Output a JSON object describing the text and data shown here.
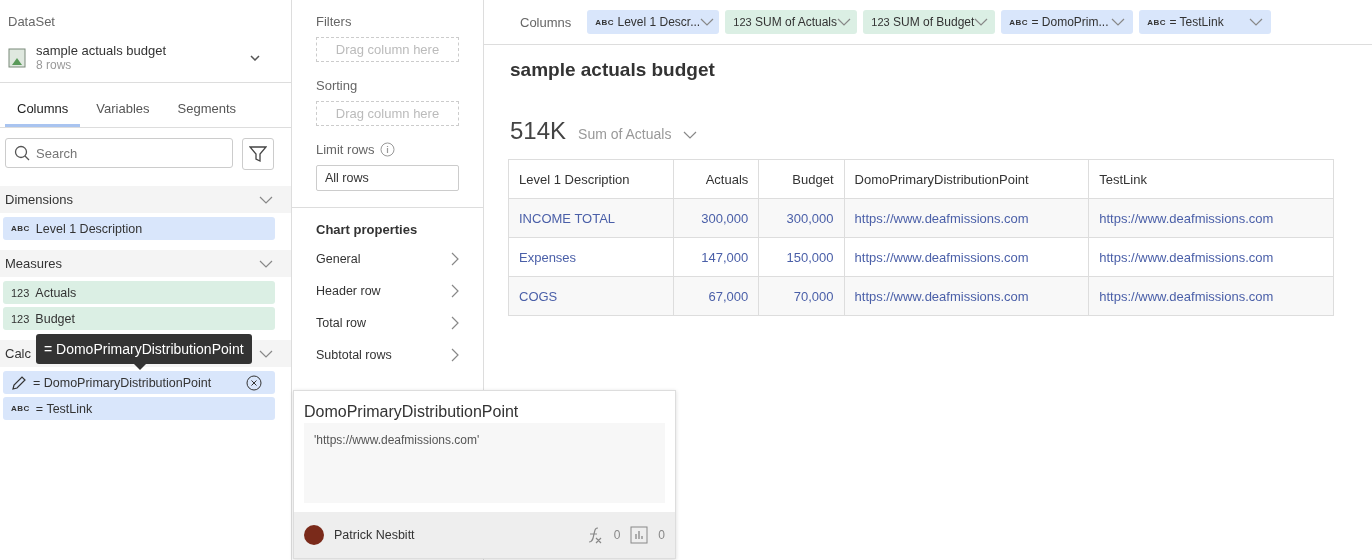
{
  "dataset": {
    "label": "DataSet",
    "name": "sample actuals budget",
    "rows": "8 rows"
  },
  "tabs": [
    {
      "label": "Columns",
      "selected": true
    },
    {
      "label": "Variables",
      "selected": false
    },
    {
      "label": "Segments",
      "selected": false
    }
  ],
  "search": {
    "placeholder": "Search"
  },
  "sections": [
    {
      "title": "Dimensions",
      "expanded": true,
      "items": [
        {
          "kind": "dimension",
          "type": "ABC",
          "label": "Level 1 Description",
          "hovered": false
        }
      ]
    },
    {
      "title": "Measures",
      "expanded": true,
      "items": [
        {
          "kind": "measure",
          "type": "123",
          "label": "Actuals",
          "hovered": false
        },
        {
          "kind": "measure",
          "type": "123",
          "label": "Budget",
          "hovered": false
        }
      ]
    },
    {
      "title": "Calc",
      "expanded": true,
      "items": [
        {
          "kind": "dimension",
          "label": "= DomoPrimaryDistributionPoint",
          "hovered": true
        },
        {
          "kind": "dimension",
          "type": "ABC",
          "label": "= TestLink",
          "hovered": false
        }
      ]
    }
  ],
  "tooltip": "= DomoPrimaryDistributionPoint",
  "filters": {
    "label": "Filters",
    "placeholder": "Drag column here"
  },
  "sorting": {
    "label": "Sorting",
    "placeholder": "Drag column here"
  },
  "limit_rows": {
    "label": "Limit rows",
    "value": "All rows"
  },
  "chart_properties": {
    "title": "Chart properties",
    "items": [
      "General",
      "Header row",
      "Total row",
      "Subtotal rows"
    ]
  },
  "columns_bar": {
    "label": "Columns",
    "chips": [
      {
        "kind": "dimension",
        "type": "ABC",
        "label": "Level 1 Descr..."
      },
      {
        "kind": "measure",
        "type": "123",
        "label": "SUM of Actuals"
      },
      {
        "kind": "measure",
        "type": "123",
        "label": "SUM of Budget"
      },
      {
        "kind": "dimension",
        "type": "ABC",
        "label": "= DomoPrim..."
      },
      {
        "kind": "dimension",
        "type": "ABC",
        "label": "= TestLink"
      }
    ]
  },
  "card": {
    "title": "sample actuals budget",
    "summary_value": "514K",
    "summary_label": "Sum of Actuals"
  },
  "table": {
    "columns": [
      "Level 1 Description",
      "Actuals",
      "Budget",
      "DomoPrimaryDistributionPoint",
      "TestLink"
    ],
    "rows": [
      [
        "INCOME TOTAL",
        "300,000",
        "300,000",
        "https://www.deafmissions.com",
        "https://www.deafmissions.com"
      ],
      [
        "Expenses",
        "147,000",
        "150,000",
        "https://www.deafmissions.com",
        "https://www.deafmissions.com"
      ],
      [
        "COGS",
        "67,000",
        "70,000",
        "https://www.deafmissions.com",
        "https://www.deafmissions.com"
      ]
    ]
  },
  "popup": {
    "title": "DomoPrimaryDistributionPoint",
    "formula": "'https://www.deafmissions.com'",
    "author": "Patrick Nesbitt",
    "formula_count": "0",
    "card_count": "0"
  }
}
